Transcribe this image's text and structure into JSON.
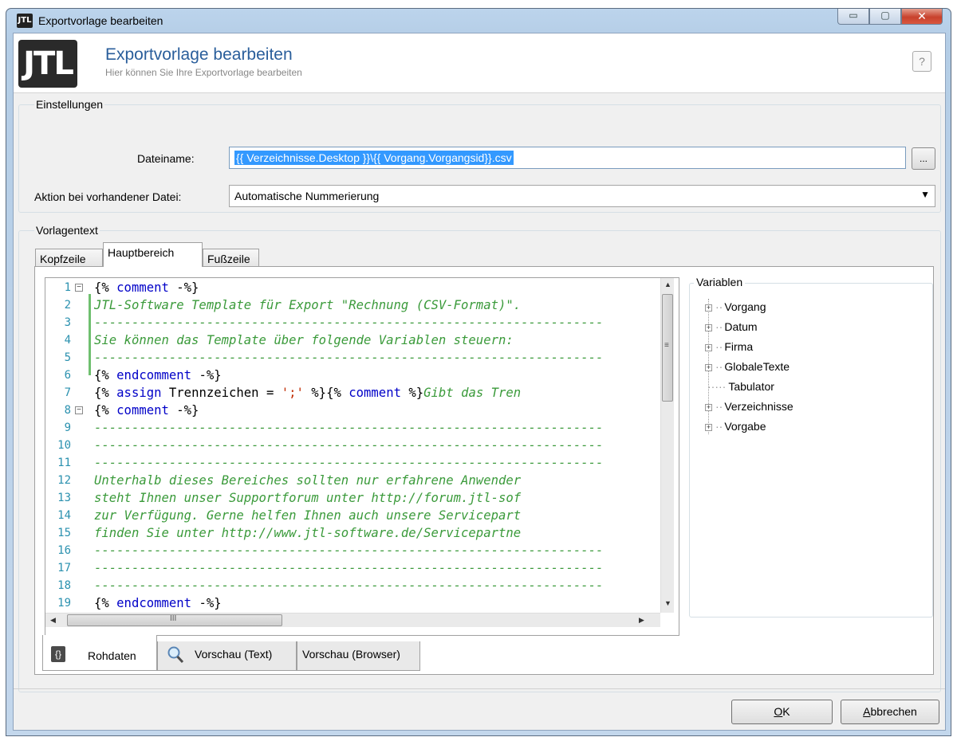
{
  "window": {
    "title": "Exportvorlage bearbeiten",
    "icon": "jtl-logo-icon",
    "min_symbol": "▭",
    "max_symbol": "▢",
    "close_symbol": "✕"
  },
  "header": {
    "logo_text": "JTL",
    "title": "Exportvorlage bearbeiten",
    "subtitle": "Hier können Sie Ihre Exportvorlage bearbeiten",
    "help_symbol": "?"
  },
  "settings": {
    "group_label": "Einstellungen",
    "filename_label": "Dateiname:",
    "filename_value": "{{ Verzeichnisse.Desktop }}\\{{ Vorgang.Vorgangsid}}.csv",
    "browse_label": "...",
    "action_label": "Aktion bei vorhandener Datei:",
    "action_value": "Automatische Nummerierung"
  },
  "template": {
    "group_label": "Vorlagentext",
    "tabs": [
      {
        "label": "Kopfzeile"
      },
      {
        "label": "Hauptbereich"
      },
      {
        "label": "Fußzeile"
      }
    ],
    "active_tab": "Hauptbereich",
    "line_numbers": [
      "1",
      "2",
      "3",
      "4",
      "5",
      "6",
      "7",
      "8",
      "9",
      "10",
      "11",
      "12",
      "13",
      "14",
      "15",
      "16",
      "17",
      "18",
      "19"
    ],
    "code_lines": [
      "{% comment -%}",
      "JTL-Software Template für Export \"Rechnung (CSV-Format)\".",
      "--------------------------------------------------------------------",
      "Sie können das Template über folgende Variablen steuern:",
      "--------------------------------------------------------------------",
      "{% endcomment -%}",
      "{% assign Trennzeichen = ';' %}{% comment %}Gibt das Tren",
      "{% comment -%}",
      "--------------------------------------------------------------------",
      "--------------------------------------------------------------------",
      "--------------------------------------------------------------------",
      "Unterhalb dieses Bereiches sollten nur erfahrene Anwender",
      "steht Ihnen unser Supportforum unter http://forum.jtl-sof",
      "zur Verfügung. Gerne helfen Ihnen auch unsere Servicepart",
      "finden Sie unter http://www.jtl-software.de/Servicepartne",
      "--------------------------------------------------------------------",
      "--------------------------------------------------------------------",
      "--------------------------------------------------------------------",
      "{% endcomment -%}"
    ],
    "scroll_grip": "≡",
    "hscroll_grip": "III",
    "variables": {
      "label": "Variablen",
      "items": [
        {
          "label": "Vorgang",
          "expandable": true
        },
        {
          "label": "Datum",
          "expandable": true
        },
        {
          "label": "Firma",
          "expandable": true
        },
        {
          "label": "GlobaleTexte",
          "expandable": true
        },
        {
          "label": "Tabulator",
          "expandable": false
        },
        {
          "label": "Verzeichnisse",
          "expandable": true
        },
        {
          "label": "Vorgabe",
          "expandable": true
        }
      ]
    },
    "bottom_tabs": [
      {
        "label": "Rohdaten"
      },
      {
        "label": "Vorschau (Text)"
      },
      {
        "label": "Vorschau (Browser)"
      }
    ]
  },
  "buttons": {
    "ok_underlined": "O",
    "ok_rest": "K",
    "cancel_underlined": "A",
    "cancel_rest": "bbrechen"
  },
  "colors": {
    "keyword": "#0000c8",
    "comment": "#3a9a3a",
    "string": "#c02a00",
    "line_number": "#2b91af",
    "selection": "#3399ff",
    "header_title": "#2a5e9b"
  }
}
